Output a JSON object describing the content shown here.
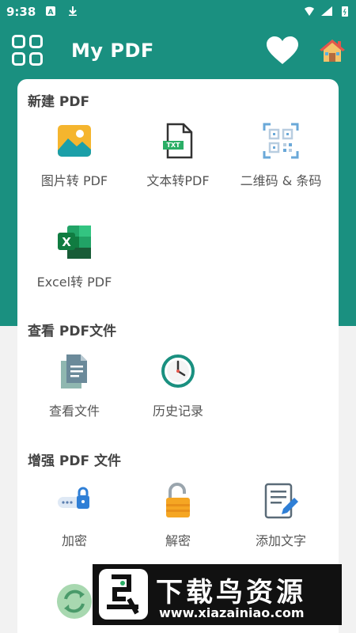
{
  "status": {
    "time": "9:38"
  },
  "appbar": {
    "title": "My PDF"
  },
  "sections": {
    "create": {
      "title": "新建 PDF",
      "items": [
        "图片转 PDF",
        "文本转PDF",
        "二维码 & 条码",
        "Excel转 PDF"
      ],
      "txt_badge": "TXT"
    },
    "view": {
      "title": "查看 PDF文件",
      "items": [
        "查看文件",
        "历史记录"
      ]
    },
    "enhance": {
      "title": "增强 PDF 文件",
      "items": [
        "加密",
        "解密",
        "添加文字"
      ]
    }
  },
  "banner": {
    "big_text": "下载鸟资源",
    "url": "www.xiazainiao.com"
  },
  "colors": {
    "primary": "#1a9080",
    "card": "#ffffff"
  }
}
